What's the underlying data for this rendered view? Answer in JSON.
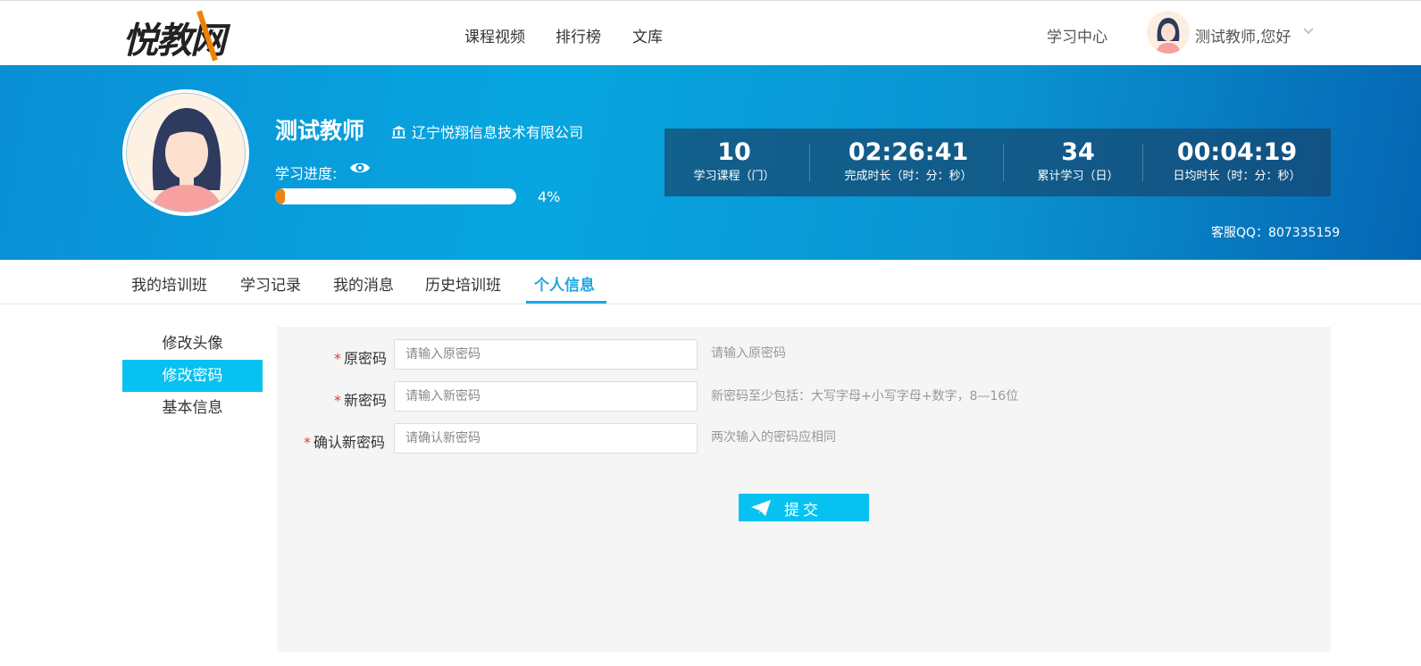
{
  "header": {
    "logo_text": "悦教网",
    "nav": [
      "课程视频",
      "排行榜",
      "文库"
    ],
    "study_center": "学习中心",
    "greeting": "测试教师,您好"
  },
  "profile": {
    "name": "测试教师",
    "org": "辽宁悦翔信息技术有限公司",
    "progress_label": "学习进度:",
    "progress_percent": 4,
    "progress_text": "4%",
    "stats": [
      {
        "value": "10",
        "label": "学习课程（门）"
      },
      {
        "value": "02:26:41",
        "label": "完成时长（时：分：秒）"
      },
      {
        "value": "34",
        "label": "累计学习（日）"
      },
      {
        "value": "00:04:19",
        "label": "日均时长（时：分：秒）"
      }
    ],
    "qq": "客服QQ：807335159"
  },
  "tabs": [
    "我的培训班",
    "学习记录",
    "我的消息",
    "历史培训班",
    "个人信息"
  ],
  "active_tab": "个人信息",
  "side_menu": [
    "修改头像",
    "修改密码",
    "基本信息"
  ],
  "active_side": "修改密码",
  "form": {
    "fields": [
      {
        "label": "原密码",
        "placeholder": "请输入原密码",
        "value": "",
        "hint": "请输入原密码"
      },
      {
        "label": "新密码",
        "placeholder": "请输入新密码",
        "value": "",
        "hint": "新密码至少包括：大写字母+小写字母+数字，8—16位"
      },
      {
        "label": "确认新密码",
        "placeholder": "请确认新密码",
        "value": "",
        "hint": "两次输入的密码应相同"
      }
    ],
    "required_mark": "*",
    "submit_label": "提交"
  },
  "colors": {
    "accent": "#07c2f0",
    "tab_active": "#1ea7e0",
    "progress": "#f0840a",
    "required": "#e23b3b"
  }
}
